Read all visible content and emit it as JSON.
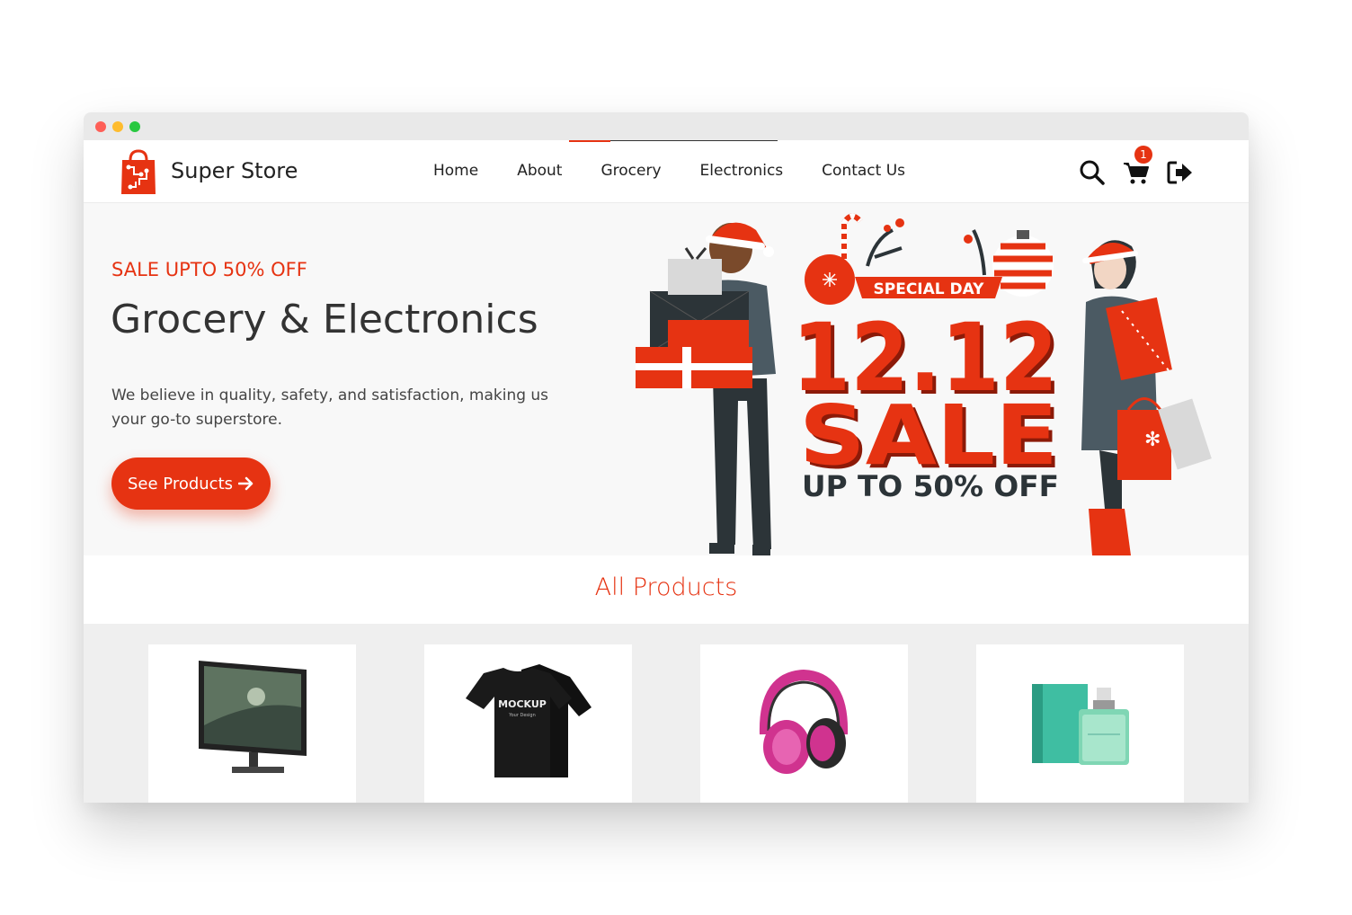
{
  "window": {
    "controls": [
      "close",
      "minimize",
      "maximize"
    ]
  },
  "header": {
    "brand": "Super Store",
    "logo_icon": "shopping-bag-icon",
    "nav": [
      {
        "label": "Home"
      },
      {
        "label": "About"
      },
      {
        "label": "Grocery"
      },
      {
        "label": "Electronics"
      },
      {
        "label": "Contact Us"
      }
    ],
    "cart_count": "1",
    "icons": [
      "search-icon",
      "cart-icon",
      "logout-icon"
    ]
  },
  "hero": {
    "promo": "SALE UPTO 50% OFF",
    "title": "Grocery & Electronics",
    "description": "We believe in quality, safety, and satisfaction, making us your go-to superstore.",
    "cta_label": "See Products",
    "cta_icon": "arrow-right-icon",
    "banner": {
      "tag": "SPECIAL DAY",
      "headline": "12.12",
      "sale": "SALE",
      "subline": "UP TO 50% OFF"
    }
  },
  "products_section": {
    "title": "All Products",
    "items": [
      {
        "image": "monitor"
      },
      {
        "image": "t-shirt",
        "print_line1": "MOCKUP",
        "print_line2": "Your Design"
      },
      {
        "image": "headphones"
      },
      {
        "image": "perfume"
      }
    ]
  },
  "colors": {
    "accent": "#e63312",
    "text": "#222222",
    "hero_bg": "#f8f8f8"
  }
}
